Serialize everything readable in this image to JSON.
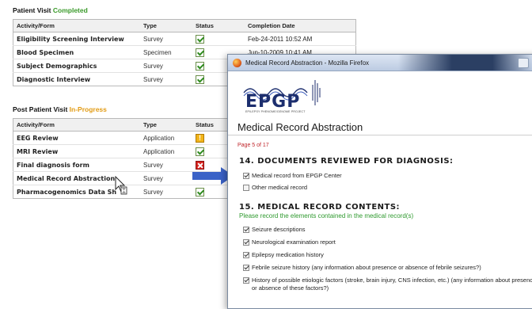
{
  "patient_visit": {
    "title_prefix": "Patient Visit",
    "title_status": "Completed",
    "headers": [
      "Activity/Form",
      "Type",
      "Status",
      "Completion Date"
    ],
    "rows": [
      {
        "name": "Eligibility Screening Interview",
        "type": "Survey",
        "status": "complete",
        "date": "Feb-24-2011 10:52 AM"
      },
      {
        "name": "Blood Specimen",
        "type": "Specimen",
        "status": "complete",
        "date": "Jun-10-2009 10:41 AM"
      },
      {
        "name": "Subject Demographics",
        "type": "Survey",
        "status": "complete",
        "date": ""
      },
      {
        "name": "Diagnostic Interview",
        "type": "Survey",
        "status": "complete",
        "date": ""
      }
    ]
  },
  "post_patient_visit": {
    "title_prefix": "Post Patient Visit",
    "title_status": "In-Progress",
    "headers": [
      "Activity/Form",
      "Type",
      "Status"
    ],
    "rows": [
      {
        "name": "EEG Review",
        "type": "Application",
        "status": "warning"
      },
      {
        "name": "MRI Review",
        "type": "Application",
        "status": "complete"
      },
      {
        "name": "Final diagnosis form",
        "type": "Survey",
        "status": "incomplete"
      },
      {
        "name": "Medical Record Abstraction",
        "type": "Survey",
        "status": "none"
      },
      {
        "name": "Pharmacogenomics Data Sh",
        "type": "Survey",
        "status": "complete"
      }
    ]
  },
  "popup": {
    "window_title": "Medical Record Abstraction - Mozilla Firefox",
    "logo_text": "EPGP",
    "logo_subtitle": "EPILEPSY PHENOME/GENOME PROJECT",
    "heading": "Medical Record Abstraction",
    "page_indicator": "Page 5 of 17",
    "section14": {
      "title": "14.  DOCUMENTS REVIEWED FOR DIAGNOSIS:",
      "options": [
        {
          "label": "Medical record from EPGP Center",
          "checked": true
        },
        {
          "label": "Other medical record",
          "checked": false
        }
      ]
    },
    "section15": {
      "title": "15.  MEDICAL RECORD CONTENTS:",
      "subtitle": "Please record the elements contained in the medical record(s)",
      "options": [
        {
          "label": "Seizure descriptions",
          "checked": true
        },
        {
          "label": "Neurological examination report",
          "checked": true
        },
        {
          "label": "Epilepsy medication history",
          "checked": true
        },
        {
          "label": "Febrile seizure history (any information about presence or absence of febrile seizures?)",
          "checked": true
        },
        {
          "label": "History of possible etiologic factors (stroke, brain injury, CNS infection, etc.) (any information about presence or absence of these factors?)",
          "checked": true
        }
      ]
    }
  },
  "colors": {
    "completed": "#3a9a2a",
    "in_progress": "#e29b14",
    "arrow": "#3a62c7",
    "page_indicator": "#c0262b"
  }
}
